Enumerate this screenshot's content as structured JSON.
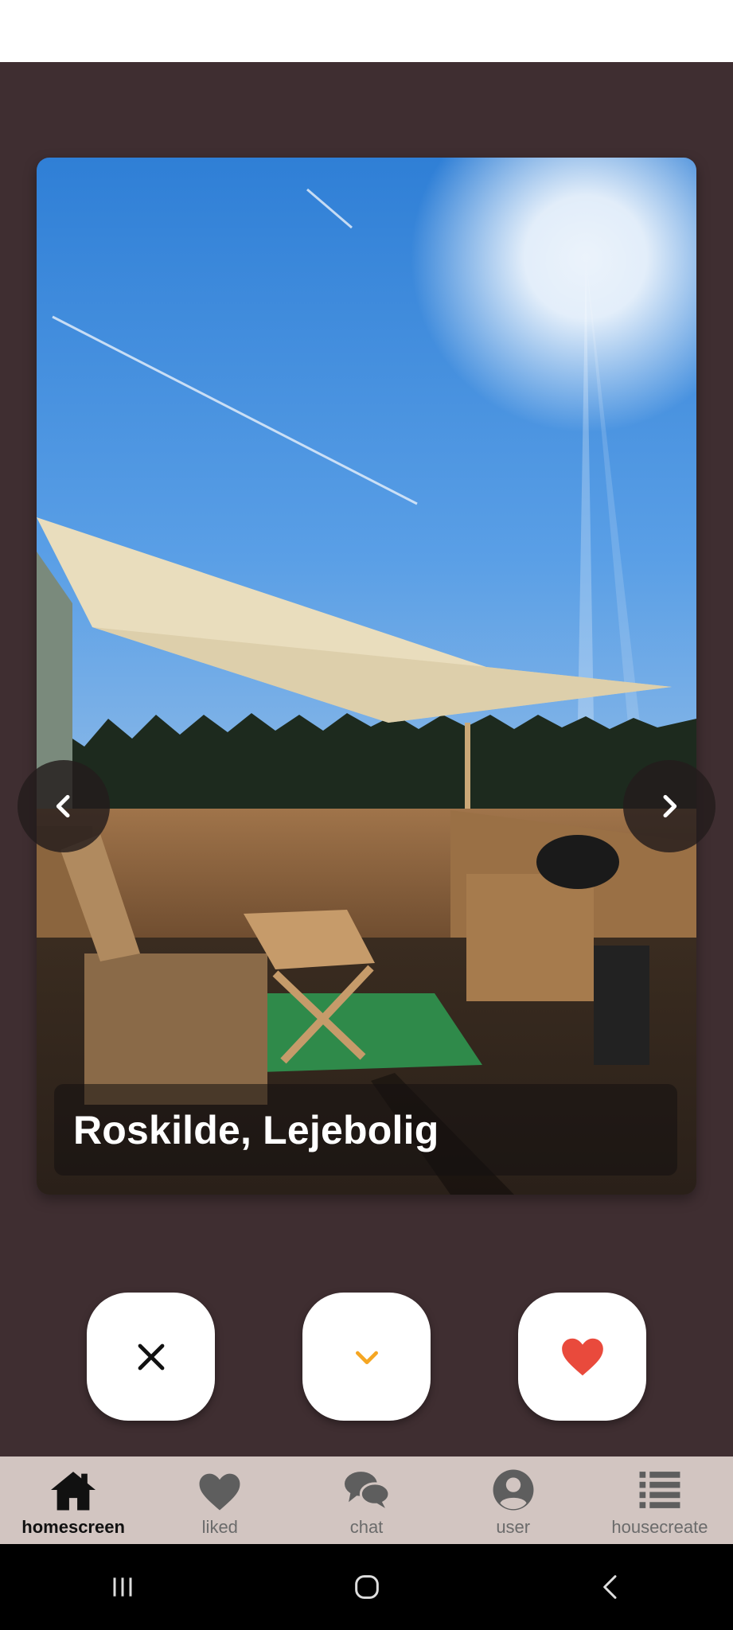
{
  "listing": {
    "title": "Roskilde, Lejebolig"
  },
  "actions": {
    "dislike_icon": "close-icon",
    "more_icon": "chevron-down-icon",
    "like_icon": "heart-icon",
    "more_color": "#f5a623",
    "like_color": "#e94a3c"
  },
  "tabs": [
    {
      "label": "homescreen",
      "icon": "home-icon",
      "active": true
    },
    {
      "label": "liked",
      "icon": "heart-icon",
      "active": false
    },
    {
      "label": "chat",
      "icon": "chat-icon",
      "active": false
    },
    {
      "label": "user",
      "icon": "user-icon",
      "active": false
    },
    {
      "label": "housecreate",
      "icon": "list-icon",
      "active": false
    }
  ],
  "colors": {
    "background": "#3f2e31",
    "tabbar": "#d2c5c1",
    "card_caption_bg": "#141010"
  }
}
